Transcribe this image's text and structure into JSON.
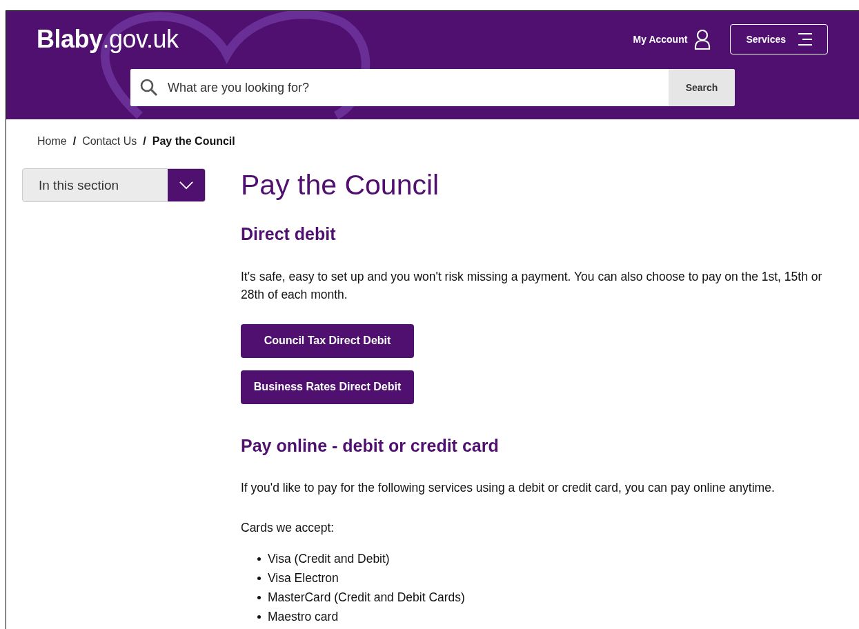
{
  "header": {
    "logo": "**Blaby**.gov.uk",
    "account_link": "My Account",
    "services_button": "Services",
    "search": {
      "placeholder": "What are you looking for?",
      "button": "Search"
    }
  },
  "breadcrumb": [
    {
      "label": "Home",
      "current": false
    },
    {
      "label": "Contact Us",
      "current": false
    },
    {
      "label": "Pay the Council",
      "current": true
    }
  ],
  "breadcrumb_separator": "/",
  "section_menu": {
    "label": "In this section",
    "expanded": false
  },
  "title": "Pay the Council",
  "sections": [
    {
      "heading": "Direct debit",
      "blocks": [
        {
          "kind": "paragraph",
          "text": "It's safe, easy to set up and you won't risk missing a payment.  You can also choose to pay on the 1st, 15th or 28th of each month."
        },
        {
          "kind": "buttons",
          "items": [
            "Council Tax Direct Debit",
            "Business Rates Direct Debit"
          ]
        }
      ]
    },
    {
      "heading": "Pay online - debit or credit card",
      "blocks": [
        {
          "kind": "paragraph",
          "text": "If you'd like to pay for the following services using a debit or credit card, you can pay online anytime."
        },
        {
          "kind": "paragraph",
          "text": "Cards we accept:"
        },
        {
          "kind": "list",
          "items": [
            "Visa (Credit and Debit)",
            "Visa Electron",
            "MasterCard (Credit and Debit Cards)",
            "Maestro card"
          ]
        }
      ]
    }
  ]
}
